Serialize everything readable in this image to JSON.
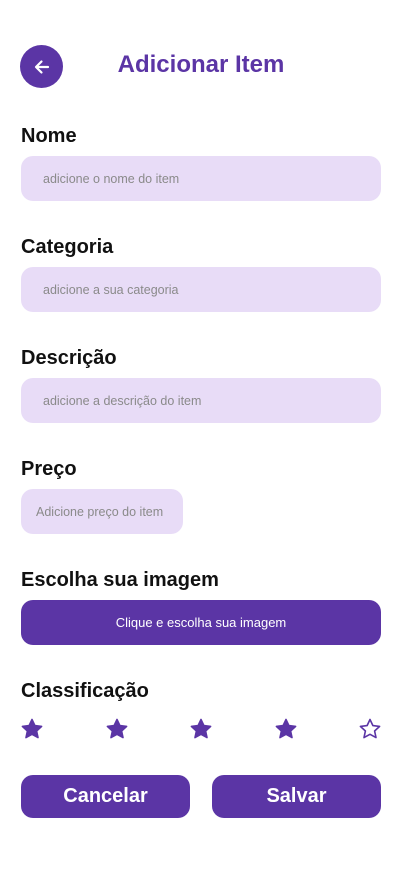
{
  "header": {
    "title": "Adicionar Item",
    "back_icon": "arrow-left-icon"
  },
  "form": {
    "name": {
      "label": "Nome",
      "placeholder": "adicione o nome do item"
    },
    "category": {
      "label": "Categoria",
      "placeholder": "adicione a sua categoria"
    },
    "description": {
      "label": "Descrição",
      "placeholder": "adicione a descrição do item"
    },
    "price": {
      "label": "Preço",
      "placeholder": "Adicione preço do item"
    },
    "image": {
      "label": "Escolha sua imagem",
      "button_label": "Clique e escolha sua imagem"
    },
    "rating": {
      "label": "Classificação",
      "value": 4,
      "max": 5
    }
  },
  "actions": {
    "cancel_label": "Cancelar",
    "save_label": "Salvar"
  },
  "colors": {
    "accent": "#5b35a5",
    "input_bg": "#e8dcf7"
  }
}
